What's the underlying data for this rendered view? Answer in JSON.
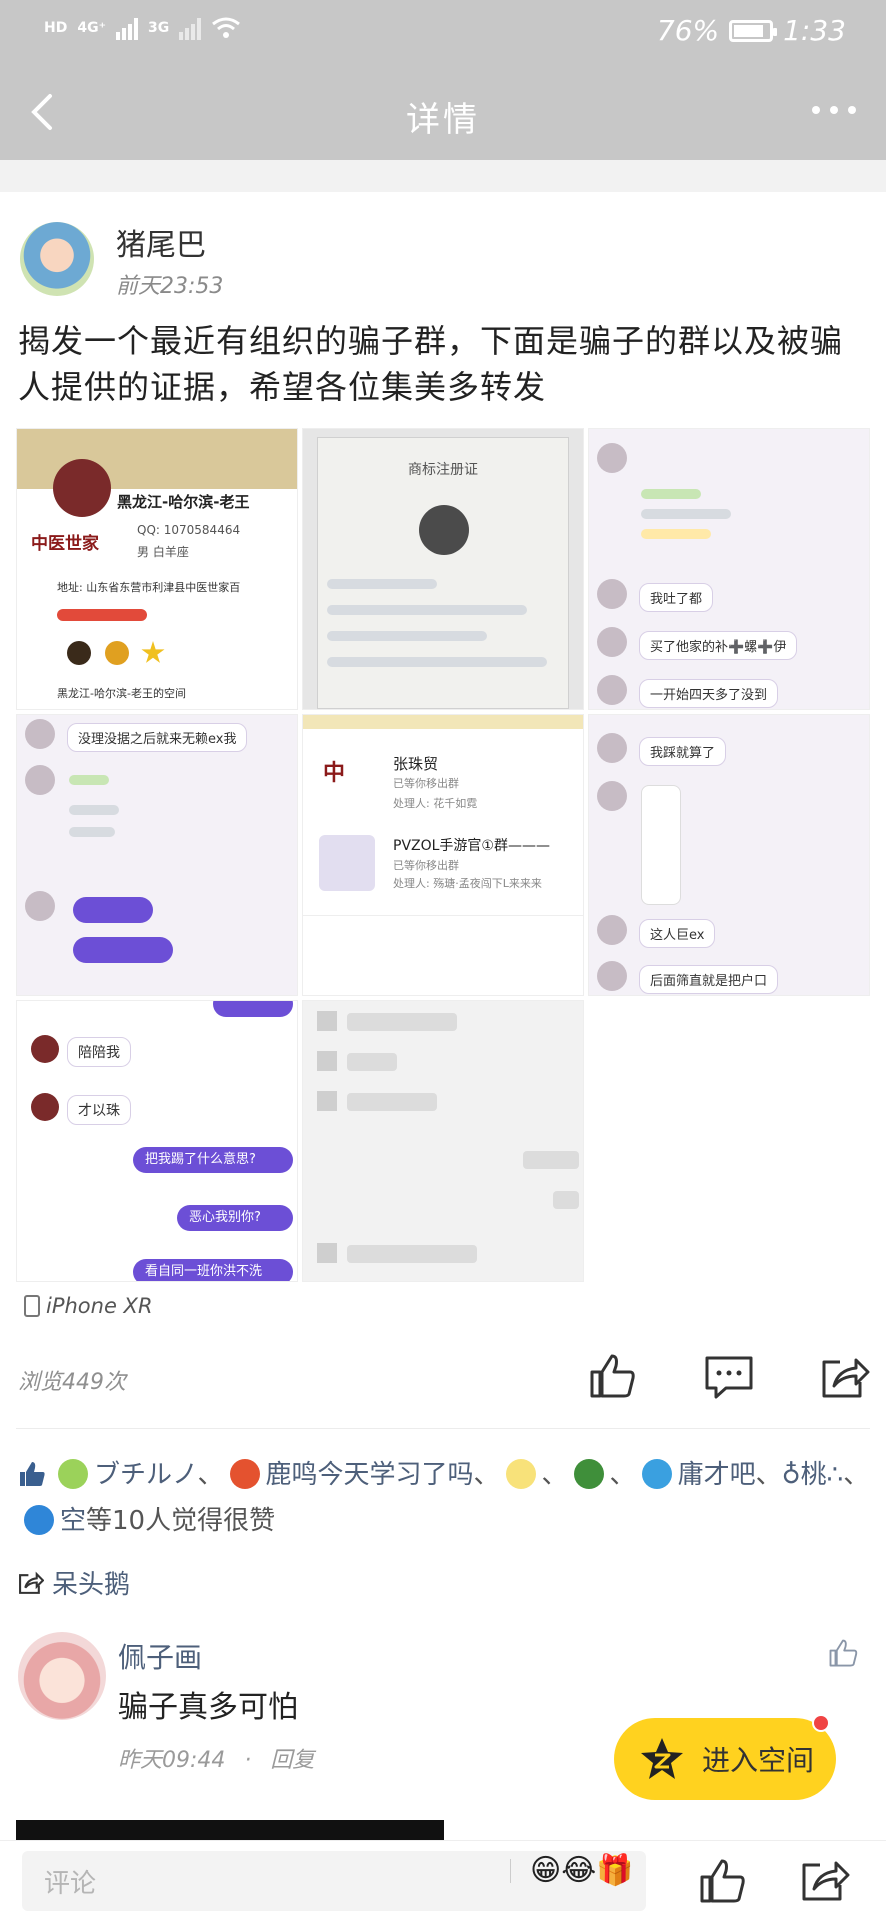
{
  "status_bar": {
    "network_1": "4G⁺",
    "network_2": "3G",
    "battery_percent": "76%",
    "battery_level": 0.76,
    "time": "1:33"
  },
  "nav": {
    "title": "详情"
  },
  "post": {
    "author": "猪尾巴",
    "time": "前天23:53",
    "text": "揭发一个最近有组织的骗子群，下面是骗子的群以及被骗人提供的证据，希望各位集美多转发",
    "images": [
      {
        "id": "img1",
        "lines": [
          "黑龙江-哈尔滨-老王",
          "中医世家",
          "QQ: 1070584464",
          "男 白羊座",
          "地址: 山东省东营市利津县中医世家百",
          "黑龙江-哈尔滨-老王的空间"
        ]
      },
      {
        "id": "img2",
        "lines": [
          "商标注册证"
        ]
      },
      {
        "id": "img3",
        "lines": [
          "我吐了都",
          "买了他家的补➕螺➕伊",
          "一开始四天多了没到"
        ]
      },
      {
        "id": "img4",
        "lines": [
          "没理没据之后就来无赖ex我"
        ]
      },
      {
        "id": "img5",
        "lines": [
          "张珠贸",
          "已等你移出群",
          "处理人: 花千如霓",
          "PVZOL手游官①群———",
          "已等你移出群",
          "处理人: 殇瑭·孟夜闯下L来来来"
        ]
      },
      {
        "id": "img6",
        "lines": [
          "我踩就算了",
          "这人巨ex",
          "后面筛直就是把户口"
        ]
      },
      {
        "id": "img7",
        "lines": [
          "陪陪我",
          "才以珠",
          "把我踢了什么意思?",
          "恶心我别你?",
          "看自同一班你洪不洗"
        ]
      },
      {
        "id": "img8",
        "lines": []
      }
    ],
    "device": "iPhone XR",
    "views": "浏览449次"
  },
  "likes": {
    "names": [
      "ブチルノ",
      "鹿鸣今天学习了吗",
      "",
      "",
      "庸才吧",
      "♁桃∴",
      "空"
    ],
    "suffix": "等10人觉得很赞",
    "separator": "、"
  },
  "share": {
    "name": "呆头鹅"
  },
  "comment": {
    "author": "佩子画",
    "text": "骗子真多可怕",
    "time": "昨天09:44",
    "dot": "·",
    "reply": "回复"
  },
  "enter_button": {
    "label": "进入空间"
  },
  "bottom_bar": {
    "placeholder": "评论",
    "emoji": "😁😂🎁"
  },
  "colors": {
    "header_gray": "#c7c7c7",
    "link_blue": "#4d5f7a",
    "accent_yellow": "#ffd21f",
    "badge_red": "#f04444",
    "chat_purple": "#6c4fd6"
  }
}
